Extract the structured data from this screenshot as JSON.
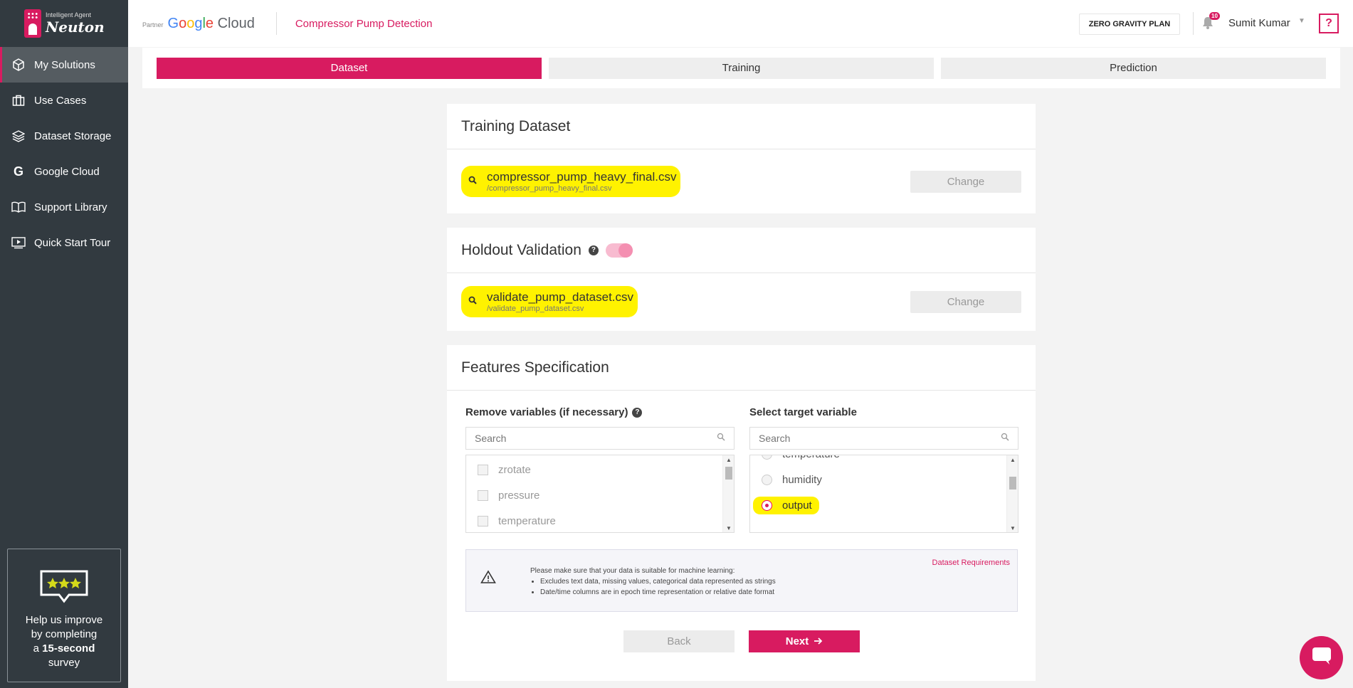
{
  "app": {
    "logo_small": "Intelligent Agent",
    "logo_big": "Neuton"
  },
  "sidebar": {
    "items": [
      {
        "label": "My Solutions",
        "icon": "cube-icon"
      },
      {
        "label": "Use Cases",
        "icon": "briefcase-icon"
      },
      {
        "label": "Dataset Storage",
        "icon": "layers-icon"
      },
      {
        "label": "Google Cloud",
        "icon": "google-g-icon"
      },
      {
        "label": "Support Library",
        "icon": "book-icon"
      },
      {
        "label": "Quick Start Tour",
        "icon": "video-play-icon"
      }
    ],
    "survey": {
      "line1": "Help us improve",
      "line2": "by completing",
      "line3_prefix": "a ",
      "line3_bold": "15-second",
      "line4": "survey"
    }
  },
  "header": {
    "partner": "Partner",
    "cloud_brand": "Google Cloud",
    "project_title": "Compressor Pump Detection",
    "plan": "ZERO GRAVITY PLAN",
    "notification_count": "10",
    "user_name": "Sumit Kumar",
    "help": "?"
  },
  "steps": [
    "Dataset",
    "Training",
    "Prediction"
  ],
  "training_dataset": {
    "title": "Training Dataset",
    "file_name": "compressor_pump_heavy_final.csv",
    "file_path": "/compressor_pump_heavy_final.csv",
    "change": "Change"
  },
  "holdout": {
    "title": "Holdout Validation",
    "file_name": "validate_pump_dataset.csv",
    "file_path": "/validate_pump_dataset.csv",
    "change": "Change"
  },
  "features": {
    "title": "Features Specification",
    "remove_title": "Remove variables (if necessary)",
    "remove_search_placeholder": "Search",
    "remove_items": [
      "zrotate",
      "pressure",
      "temperature"
    ],
    "target_title": "Select target variable",
    "target_search_placeholder": "Search",
    "target_items": [
      "temperature",
      "humidity",
      "output"
    ],
    "target_selected": "output",
    "info_title": "Please make sure that your data is suitable for machine learning:",
    "info_bullets": [
      "Excludes text data, missing values, categorical data represented as strings",
      "Date/time columns are in epoch time representation or relative date format"
    ],
    "requirements_link": "Dataset Requirements",
    "back": "Back",
    "next": "Next"
  },
  "colors": {
    "accent": "#d81b60",
    "sidebar_bg": "#323a40",
    "highlight": "#fff200"
  }
}
